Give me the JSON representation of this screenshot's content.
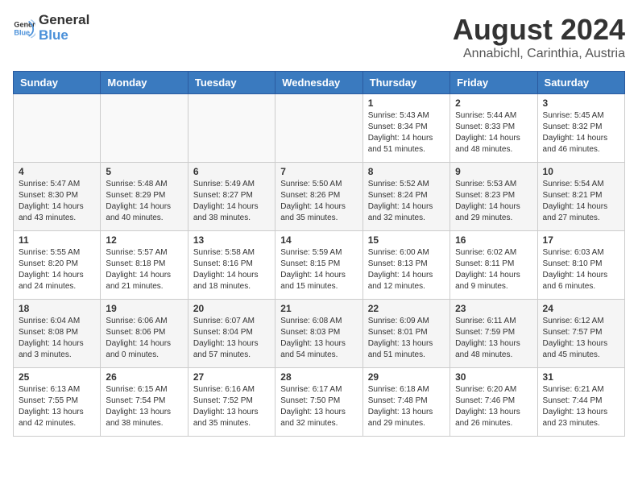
{
  "logo": {
    "text_general": "General",
    "text_blue": "Blue"
  },
  "title": {
    "month_year": "August 2024",
    "location": "Annabichl, Carinthia, Austria"
  },
  "days_of_week": [
    "Sunday",
    "Monday",
    "Tuesday",
    "Wednesday",
    "Thursday",
    "Friday",
    "Saturday"
  ],
  "weeks": [
    [
      {
        "day": "",
        "info": ""
      },
      {
        "day": "",
        "info": ""
      },
      {
        "day": "",
        "info": ""
      },
      {
        "day": "",
        "info": ""
      },
      {
        "day": "1",
        "info": "Sunrise: 5:43 AM\nSunset: 8:34 PM\nDaylight: 14 hours\nand 51 minutes."
      },
      {
        "day": "2",
        "info": "Sunrise: 5:44 AM\nSunset: 8:33 PM\nDaylight: 14 hours\nand 48 minutes."
      },
      {
        "day": "3",
        "info": "Sunrise: 5:45 AM\nSunset: 8:32 PM\nDaylight: 14 hours\nand 46 minutes."
      }
    ],
    [
      {
        "day": "4",
        "info": "Sunrise: 5:47 AM\nSunset: 8:30 PM\nDaylight: 14 hours\nand 43 minutes."
      },
      {
        "day": "5",
        "info": "Sunrise: 5:48 AM\nSunset: 8:29 PM\nDaylight: 14 hours\nand 40 minutes."
      },
      {
        "day": "6",
        "info": "Sunrise: 5:49 AM\nSunset: 8:27 PM\nDaylight: 14 hours\nand 38 minutes."
      },
      {
        "day": "7",
        "info": "Sunrise: 5:50 AM\nSunset: 8:26 PM\nDaylight: 14 hours\nand 35 minutes."
      },
      {
        "day": "8",
        "info": "Sunrise: 5:52 AM\nSunset: 8:24 PM\nDaylight: 14 hours\nand 32 minutes."
      },
      {
        "day": "9",
        "info": "Sunrise: 5:53 AM\nSunset: 8:23 PM\nDaylight: 14 hours\nand 29 minutes."
      },
      {
        "day": "10",
        "info": "Sunrise: 5:54 AM\nSunset: 8:21 PM\nDaylight: 14 hours\nand 27 minutes."
      }
    ],
    [
      {
        "day": "11",
        "info": "Sunrise: 5:55 AM\nSunset: 8:20 PM\nDaylight: 14 hours\nand 24 minutes."
      },
      {
        "day": "12",
        "info": "Sunrise: 5:57 AM\nSunset: 8:18 PM\nDaylight: 14 hours\nand 21 minutes."
      },
      {
        "day": "13",
        "info": "Sunrise: 5:58 AM\nSunset: 8:16 PM\nDaylight: 14 hours\nand 18 minutes."
      },
      {
        "day": "14",
        "info": "Sunrise: 5:59 AM\nSunset: 8:15 PM\nDaylight: 14 hours\nand 15 minutes."
      },
      {
        "day": "15",
        "info": "Sunrise: 6:00 AM\nSunset: 8:13 PM\nDaylight: 14 hours\nand 12 minutes."
      },
      {
        "day": "16",
        "info": "Sunrise: 6:02 AM\nSunset: 8:11 PM\nDaylight: 14 hours\nand 9 minutes."
      },
      {
        "day": "17",
        "info": "Sunrise: 6:03 AM\nSunset: 8:10 PM\nDaylight: 14 hours\nand 6 minutes."
      }
    ],
    [
      {
        "day": "18",
        "info": "Sunrise: 6:04 AM\nSunset: 8:08 PM\nDaylight: 14 hours\nand 3 minutes."
      },
      {
        "day": "19",
        "info": "Sunrise: 6:06 AM\nSunset: 8:06 PM\nDaylight: 14 hours\nand 0 minutes."
      },
      {
        "day": "20",
        "info": "Sunrise: 6:07 AM\nSunset: 8:04 PM\nDaylight: 13 hours\nand 57 minutes."
      },
      {
        "day": "21",
        "info": "Sunrise: 6:08 AM\nSunset: 8:03 PM\nDaylight: 13 hours\nand 54 minutes."
      },
      {
        "day": "22",
        "info": "Sunrise: 6:09 AM\nSunset: 8:01 PM\nDaylight: 13 hours\nand 51 minutes."
      },
      {
        "day": "23",
        "info": "Sunrise: 6:11 AM\nSunset: 7:59 PM\nDaylight: 13 hours\nand 48 minutes."
      },
      {
        "day": "24",
        "info": "Sunrise: 6:12 AM\nSunset: 7:57 PM\nDaylight: 13 hours\nand 45 minutes."
      }
    ],
    [
      {
        "day": "25",
        "info": "Sunrise: 6:13 AM\nSunset: 7:55 PM\nDaylight: 13 hours\nand 42 minutes."
      },
      {
        "day": "26",
        "info": "Sunrise: 6:15 AM\nSunset: 7:54 PM\nDaylight: 13 hours\nand 38 minutes."
      },
      {
        "day": "27",
        "info": "Sunrise: 6:16 AM\nSunset: 7:52 PM\nDaylight: 13 hours\nand 35 minutes."
      },
      {
        "day": "28",
        "info": "Sunrise: 6:17 AM\nSunset: 7:50 PM\nDaylight: 13 hours\nand 32 minutes."
      },
      {
        "day": "29",
        "info": "Sunrise: 6:18 AM\nSunset: 7:48 PM\nDaylight: 13 hours\nand 29 minutes."
      },
      {
        "day": "30",
        "info": "Sunrise: 6:20 AM\nSunset: 7:46 PM\nDaylight: 13 hours\nand 26 minutes."
      },
      {
        "day": "31",
        "info": "Sunrise: 6:21 AM\nSunset: 7:44 PM\nDaylight: 13 hours\nand 23 minutes."
      }
    ]
  ]
}
